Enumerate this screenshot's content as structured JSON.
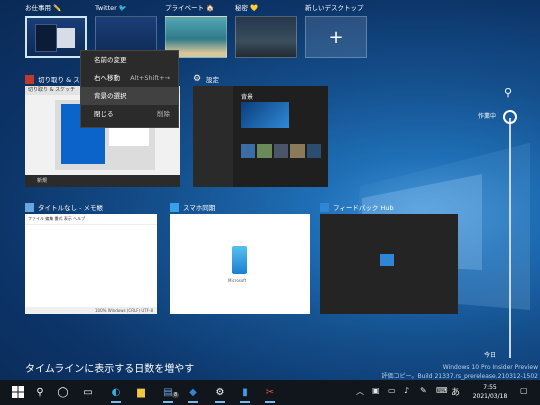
{
  "desktops": [
    {
      "name": "お仕事用",
      "badge": "✏️"
    },
    {
      "name": "Twitter",
      "badge": "🐦"
    },
    {
      "name": "プライベート",
      "badge": "🏠"
    },
    {
      "name": "秘密",
      "badge": "💛"
    },
    {
      "name": "新しいデスクトップ",
      "badge": ""
    }
  ],
  "context_menu": {
    "items": [
      {
        "label": "名前の変更",
        "shortcut": ""
      },
      {
        "label": "右へ移動",
        "shortcut": "Alt+Shift+→"
      },
      {
        "label": "背景の選択",
        "shortcut": ""
      },
      {
        "label": "閉じる",
        "shortcut": "削除"
      }
    ]
  },
  "windows": {
    "snip": {
      "title": "切り取り & スケッチ",
      "inner_title": "切り取り & スケッチ",
      "new_label": "新規"
    },
    "settings": {
      "title": "設定",
      "inner_heading": "背景"
    },
    "notepad": {
      "title": "タイトルなし - メモ帳",
      "menu": "ファイル 編集 書式 表示 ヘルプ",
      "status": "100%  Windows (CRLF)  UTF-8"
    },
    "phone": {
      "title": "スマホ同期",
      "ms": "Microsoft"
    },
    "feedback": {
      "title": "フィードバック Hub"
    }
  },
  "timeline": {
    "section": "作業中",
    "today": "今日",
    "extend": "タイムラインに表示する日数を増やす"
  },
  "watermark": {
    "line1": "Windows 10 Pro Insider Preview",
    "line2": "評価コピー。Build 21337.rs_prerelease.210312-1502"
  },
  "taskbar": {
    "time": "7:55",
    "date": "2021/03/18",
    "ime": "あ",
    "badge_count": "8"
  },
  "colors": {
    "accent": "#0a64c9",
    "taskbar": "#11151c",
    "menu_bg": "#2b2b2b"
  }
}
